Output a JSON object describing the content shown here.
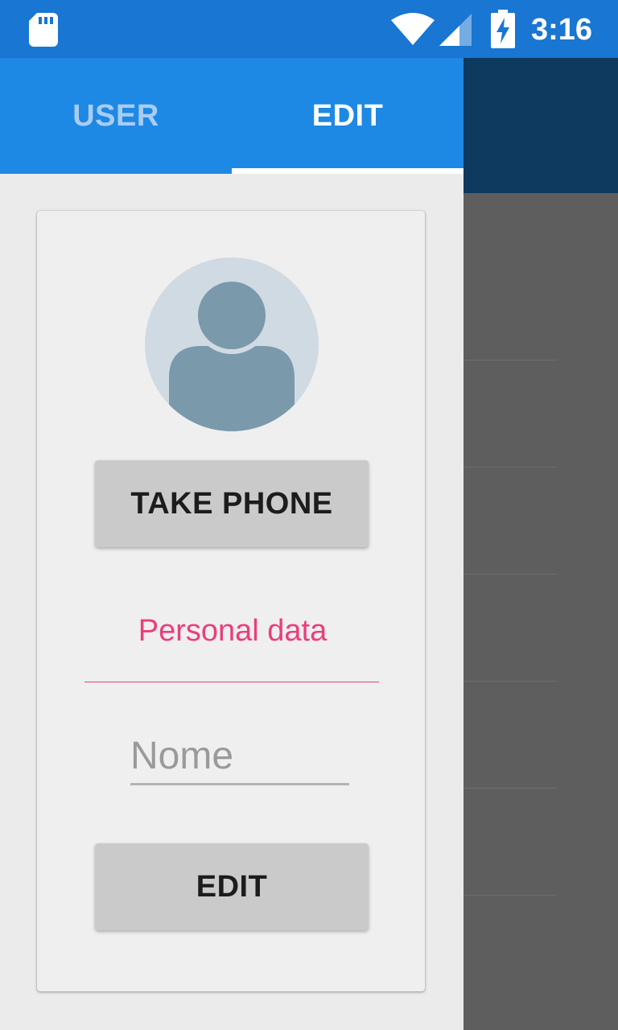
{
  "status_bar": {
    "time": "3:16",
    "icons": [
      "sd-card-icon",
      "wifi-icon",
      "signal-icon",
      "battery-charging-icon"
    ],
    "background": "#1976d2"
  },
  "tabs": [
    {
      "label": "USER",
      "selected": false
    },
    {
      "label": "EDIT",
      "selected": true
    }
  ],
  "profile": {
    "avatar": "person-placeholder-icon",
    "take_photo_label": "TAKE PHONE"
  },
  "section": {
    "title": "Personal data"
  },
  "form": {
    "name_value": "",
    "name_placeholder": "Nome",
    "edit_label": "EDIT"
  },
  "colors": {
    "tab_bar": "#1e88e5",
    "accent": "#e93f7b",
    "button": "#c9cac9",
    "background_appbar": "#0d3a5e",
    "scrim": "#5e5e5e"
  }
}
